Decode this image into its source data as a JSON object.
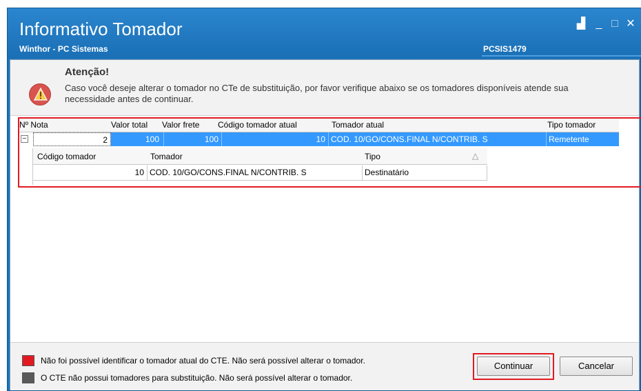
{
  "window": {
    "title": "Informativo Tomador",
    "subtitle": "Winthor - PC Sistemas",
    "code": "PCSIS1479",
    "restore_glyph": "▟",
    "minimize_glyph": "_",
    "maximize_glyph": "□",
    "close_glyph": "✕"
  },
  "alert": {
    "title": "Atenção!",
    "message": "Caso você deseje alterar o tomador no CTe de substituição, por favor verifique abaixo se os tomadores disponíveis atende sua necessidade antes de continuar.",
    "icon": "warning-icon",
    "icon_color": "#d9534f"
  },
  "main_grid": {
    "headers": {
      "nota": "Nº Nota",
      "valor_total": "Valor total",
      "valor_frete": "Valor frete",
      "codigo_tomador_atual": "Código tomador atual",
      "tomador_atual": "Tomador atual",
      "tipo_tomador": "Tipo tomador"
    },
    "row": {
      "expander": "⊟",
      "nota": "2",
      "valor_total": "100",
      "valor_frete": "100",
      "codigo_tomador_atual": "10",
      "tomador_atual": "COD. 10/GO/CONS.FINAL N/CONTRIB. S",
      "tipo_tomador": "Remetente"
    }
  },
  "sub_grid": {
    "headers": {
      "codigo_tomador": "Código tomador",
      "tomador": "Tomador",
      "tipo": "Tipo",
      "sort_glyph": "△"
    },
    "row": {
      "codigo_tomador": "10",
      "tomador": "COD. 10/GO/CONS.FINAL N/CONTRIB. S",
      "tipo": "Destinatário"
    }
  },
  "legend": {
    "items": [
      {
        "color": "#e11a22",
        "text": "Não foi possível identificar o tomador atual do CTE. Não será possível alterar o tomador."
      },
      {
        "color": "#5a5a5a",
        "text": "O CTE não possui tomadores para substituição. Não será possível alterar o tomador."
      }
    ]
  },
  "buttons": {
    "continue": "Continuar",
    "cancel": "Cancelar"
  },
  "colors": {
    "title_bar": "#1c73b8",
    "selection": "#3399ff",
    "highlight": "#e11a22"
  }
}
